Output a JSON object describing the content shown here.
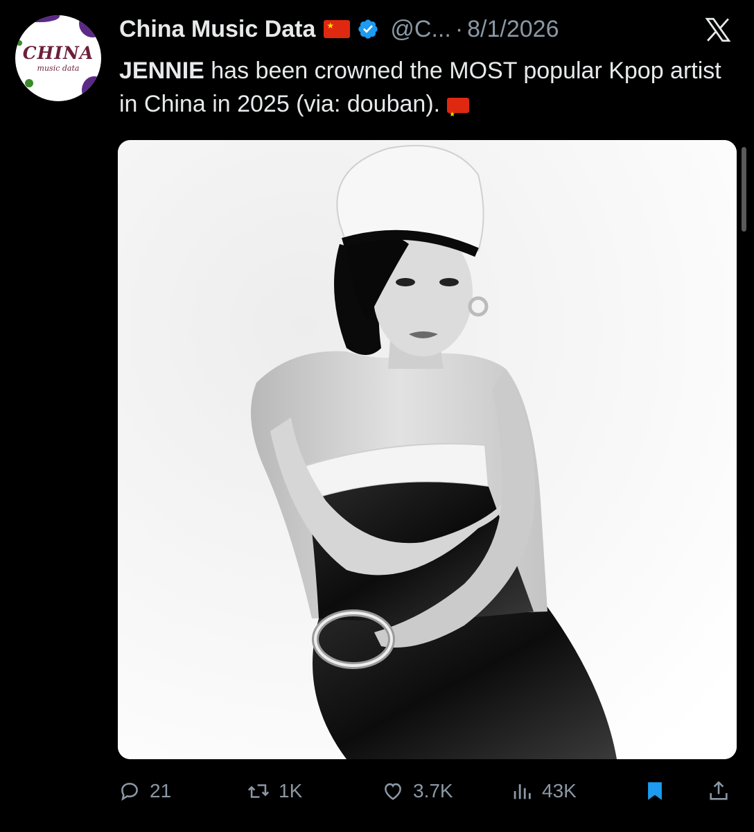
{
  "tweet": {
    "avatar": {
      "logo_text": "CHINA",
      "logo_subtext": "music data",
      "colors": {
        "primary": "#6b1f3a",
        "purple": "#5b2a86",
        "green": "#3a8a2a"
      }
    },
    "author": {
      "display_name": "China Music Data",
      "handle": "@C...",
      "verified": true
    },
    "separator": "·",
    "date": "8/1/2026",
    "text": {
      "bold_lead": "JENNIE",
      "body": " has been crowned the MOST popular Kpop artist in China in 2025 (via: douban)."
    },
    "media": {
      "alt": "Black and white photo of a woman in a white beret and strapless dress"
    },
    "actions": {
      "replies": "21",
      "reposts": "1K",
      "likes": "3.7K",
      "views": "43K"
    }
  },
  "theme": {
    "background": "#000000",
    "text": "#e7e9ea",
    "muted": "#8b98a5",
    "verified_blue": "#1d9bf0",
    "bookmark_blue": "#1d9bf0",
    "flag_red": "#de2910"
  },
  "icons": [
    "x-logo-icon",
    "verified-badge-icon",
    "china-flag-icon",
    "reply-icon",
    "repost-icon",
    "like-icon",
    "views-icon",
    "bookmark-icon",
    "share-icon"
  ]
}
